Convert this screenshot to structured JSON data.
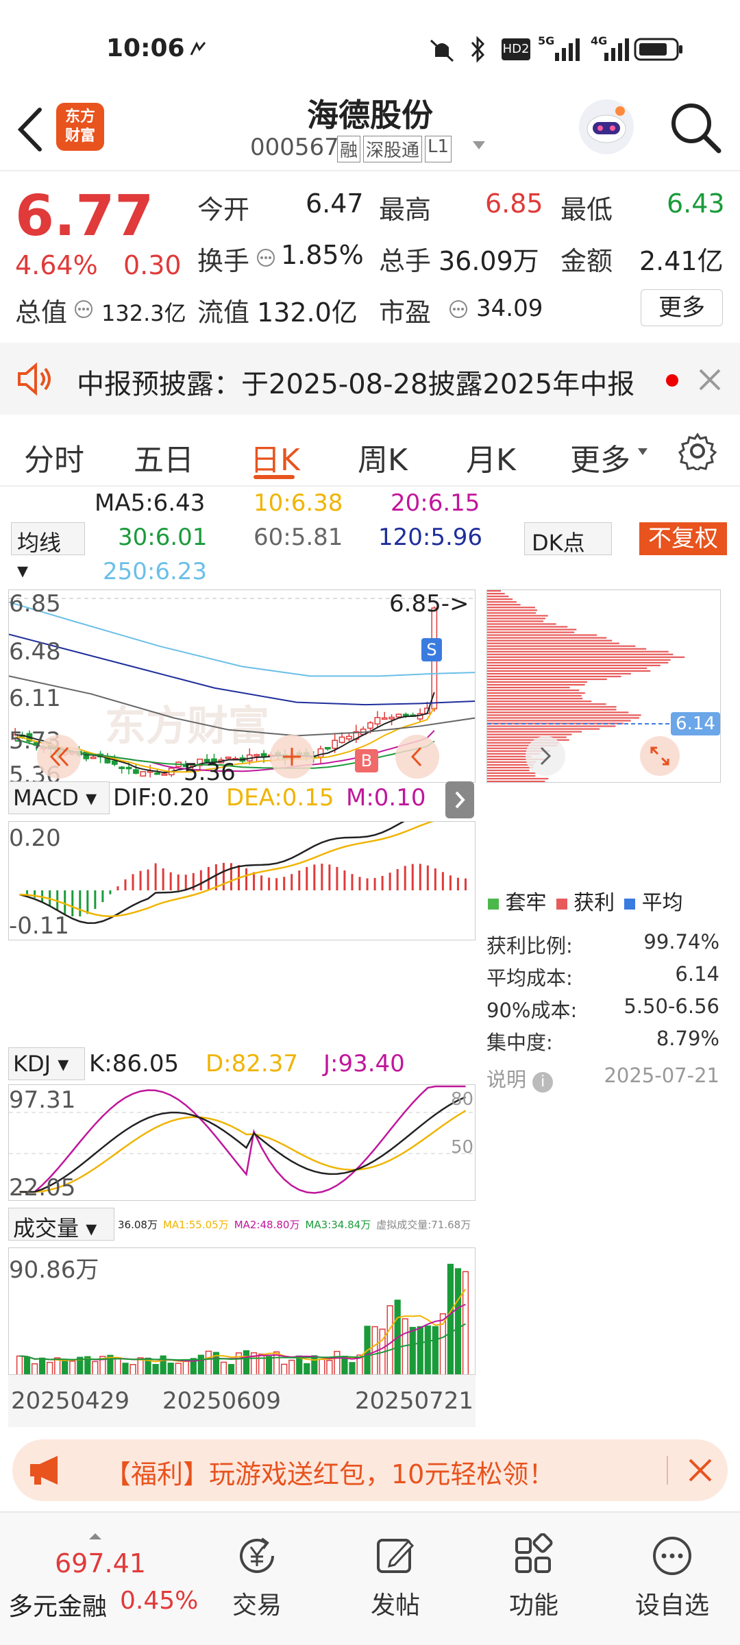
{
  "status": {
    "time": "10:06",
    "network": "5G",
    "network2": "4G",
    "hd": "HD2"
  },
  "header": {
    "title": "海德股份",
    "code": "000567",
    "tags": [
      "融",
      "深股通",
      "L1"
    ],
    "logo_line1": "东方",
    "logo_line2": "财富"
  },
  "quote": {
    "price": "6.77",
    "pct": "4.64%",
    "chg": "0.30",
    "fields": [
      {
        "label": "今开",
        "value": "6.47",
        "color": "#222"
      },
      {
        "label": "最高",
        "value": "6.85",
        "color": "#e03a3a"
      },
      {
        "label": "最低",
        "value": "6.43",
        "color": "#1a9b3a"
      },
      {
        "label": "换手",
        "value": "1.85%",
        "color": "#222"
      },
      {
        "label": "总手",
        "value": "36.09万",
        "color": "#222"
      },
      {
        "label": "金额",
        "value": "2.41亿",
        "color": "#222"
      },
      {
        "label": "总值",
        "value": "132.3亿",
        "color": "#222"
      },
      {
        "label": "流值",
        "value": "132.0亿",
        "color": "#222"
      },
      {
        "label": "市盈",
        "value": "34.09",
        "color": "#222"
      }
    ],
    "more": "更多"
  },
  "notice": {
    "text": "中报预披露：于2025-08-28披露2025年中报"
  },
  "tabs": [
    "分时",
    "五日",
    "日K",
    "周K",
    "月K",
    "更多"
  ],
  "ma": {
    "selector": "均线",
    "ma5": "MA5:6.43",
    "ma10": "10:6.38",
    "ma20": "20:6.15",
    "ma30": "30:6.01",
    "ma60": "60:5.81",
    "ma120": "120:5.96",
    "ma250": "250:6.23",
    "dk": "DK点",
    "fq": "不复权"
  },
  "kline": {
    "y_labels": [
      "6.85",
      "6.48",
      "6.11",
      "5.73",
      "5.36"
    ],
    "high_mark": "6.85->",
    "low_mark": "5.36",
    "s_tag": "S",
    "b_tag": "B",
    "watermark": "东方财富",
    "cost_tag": "6.14"
  },
  "macd": {
    "selector": "MACD",
    "dif": "DIF:0.20",
    "dea": "DEA:0.15",
    "m": "M:0.10",
    "y_top": "0.20",
    "y_bottom": "-0.11"
  },
  "kdj": {
    "selector": "KDJ",
    "k": "K:86.05",
    "d": "D:82.37",
    "j": "J:93.40",
    "y_top": "97.31",
    "y_bottom": "22.05",
    "ref80": "80",
    "ref50": "50"
  },
  "volume": {
    "selector": "成交量",
    "v": "36.08万",
    "ma1": "MA1:55.05万",
    "ma2": "MA2:48.80万",
    "ma3": "MA3:34.84万",
    "virtual": "虚拟成交量:71.68万",
    "y_top": "90.86万",
    "dates": [
      "20250429",
      "20250609",
      "20250721"
    ]
  },
  "chips": {
    "legend": [
      "套牢",
      "获利",
      "平均"
    ],
    "rows": [
      {
        "label": "获利比例:",
        "value": "99.74%"
      },
      {
        "label": "平均成本:",
        "value": "6.14"
      },
      {
        "label": "90%成本:",
        "value": "5.50-6.56"
      },
      {
        "label": "集中度:",
        "value": "8.79%"
      }
    ],
    "note": "说明",
    "date": "2025-07-21"
  },
  "ad": {
    "text": "【福利】玩游戏送红包，10元轻松领！"
  },
  "bottom": {
    "index_value": "697.41",
    "index_name": "多元金融",
    "index_pct": "0.45%",
    "items": [
      "交易",
      "发帖",
      "功能",
      "设自选"
    ]
  },
  "colors": {
    "up": "#e03a3a",
    "down": "#1a9b3a",
    "accent": "#e8531e",
    "ma5": "#222222",
    "ma10": "#f0b400",
    "ma20": "#c0169b",
    "ma30": "#1a9b3a",
    "ma60": "#666666",
    "ma120": "#1e2e9b",
    "ma250": "#6bbfe8"
  }
}
